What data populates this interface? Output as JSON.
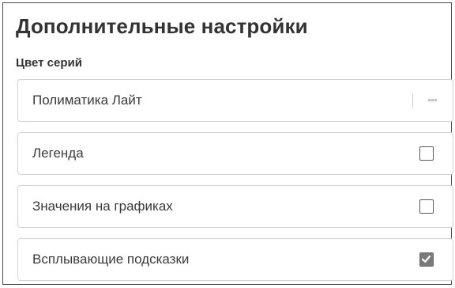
{
  "panel": {
    "title": "Дополнительные настройки",
    "series_color_label": "Цвет серий"
  },
  "series_color_select": {
    "value": "Полиматика Лайт",
    "icon": "ellipsis-icon"
  },
  "options": [
    {
      "label": "Легенда",
      "checked": false
    },
    {
      "label": "Значения на графиках",
      "checked": false
    },
    {
      "label": "Всплывающие подсказки",
      "checked": true
    }
  ],
  "colors": {
    "border": "#d2d2d2",
    "text": "#3a3a3a",
    "checked_fill": "#7a7a7a"
  }
}
